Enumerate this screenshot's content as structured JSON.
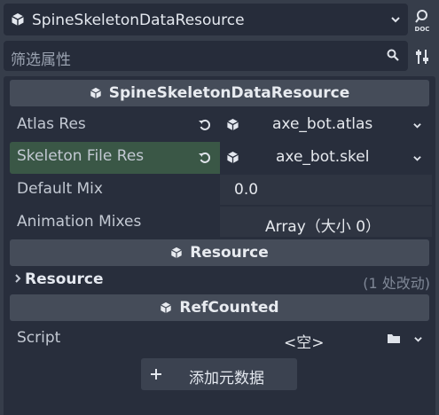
{
  "resource_selector": {
    "value": "SpineSkeletonDataResource",
    "icon": "cube-icon"
  },
  "doc_button": {
    "icon": "doc-search-icon",
    "label": "DOC"
  },
  "filter": {
    "placeholder": "筛选属性",
    "icon": "search-icon"
  },
  "tools_button": {
    "icon": "sliders-icon"
  },
  "sections": {
    "main": {
      "title": "SpineSkeletonDataResource"
    },
    "resource": {
      "title": "Resource"
    },
    "refcounted": {
      "title": "RefCounted"
    }
  },
  "properties": {
    "atlas_res": {
      "label": "Atlas Res",
      "value": "axe_bot.atlas"
    },
    "skeleton_file_res": {
      "label": "Skeleton File Res",
      "value": "axe_bot.skel"
    },
    "default_mix": {
      "label": "Default Mix",
      "value": "0.0"
    },
    "animation_mixes": {
      "label": "Animation Mixes",
      "value": "Array（大小 0）"
    }
  },
  "resource_group": {
    "label": "Resource",
    "changes": "(1 处改动)"
  },
  "script": {
    "label": "Script",
    "value": "<空>"
  },
  "add_metadata": {
    "label": "添加元数据"
  },
  "colors": {
    "background": "#363d4a",
    "panel": "#282e3c",
    "header": "#454c59",
    "modified_row": "#3a5746"
  }
}
